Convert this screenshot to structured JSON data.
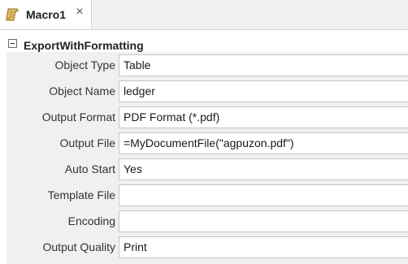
{
  "tab": {
    "title": "Macro1",
    "icon": "macro-scroll-icon",
    "close_icon": "close-icon",
    "close_glyph": "×"
  },
  "action": {
    "name": "ExportWithFormatting",
    "expand_icon": "collapse-icon"
  },
  "arguments": [
    {
      "label": "Object Type",
      "value": "Table"
    },
    {
      "label": "Object Name",
      "value": "ledger"
    },
    {
      "label": "Output Format",
      "value": "PDF Format (*.pdf)"
    },
    {
      "label": "Output File",
      "value": "=MyDocumentFile(\"agpuzon.pdf\")"
    },
    {
      "label": "Auto Start",
      "value": "Yes"
    },
    {
      "label": "Template File",
      "value": ""
    },
    {
      "label": "Encoding",
      "value": ""
    },
    {
      "label": "Output Quality",
      "value": "Print"
    }
  ]
}
